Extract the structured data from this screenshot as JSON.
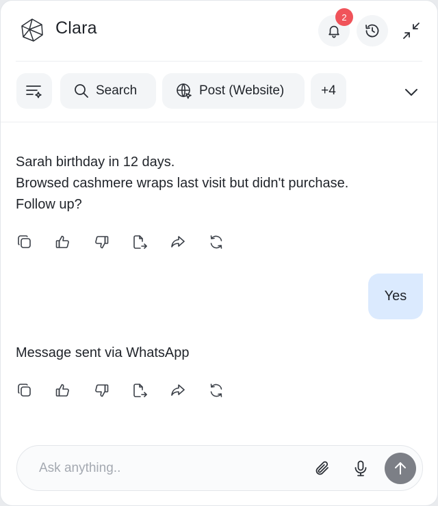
{
  "app": {
    "title": "Clara",
    "notification_count": "2"
  },
  "toolbar": {
    "search_label": "Search",
    "post_label": "Post (Website)",
    "more_label": "+4"
  },
  "messages": {
    "assistant_1": {
      "lines": [
        "Sarah birthday in 12 days.",
        "Browsed cashmere wraps last visit but didn't purchase.",
        "Follow up?"
      ]
    },
    "user_1": "Yes",
    "assistant_2": "Message sent via WhatsApp"
  },
  "input": {
    "placeholder": "Ask anything.."
  },
  "icons": {
    "header": [
      "logo-icon",
      "bell-icon",
      "history-icon",
      "collapse-icon"
    ],
    "toolbar": [
      "filter-icon",
      "search-icon",
      "globe-icon",
      "chevron-down-icon"
    ],
    "message_actions": [
      "copy-icon",
      "thumbs-up-icon",
      "thumbs-down-icon",
      "export-icon",
      "share-icon",
      "regenerate-icon"
    ],
    "composer": [
      "attach-icon",
      "mic-icon",
      "send-arrow-icon"
    ]
  },
  "colors": {
    "badge": "#f0535a",
    "user_bubble": "#dbeafe",
    "send_button": "#7c7f86"
  }
}
